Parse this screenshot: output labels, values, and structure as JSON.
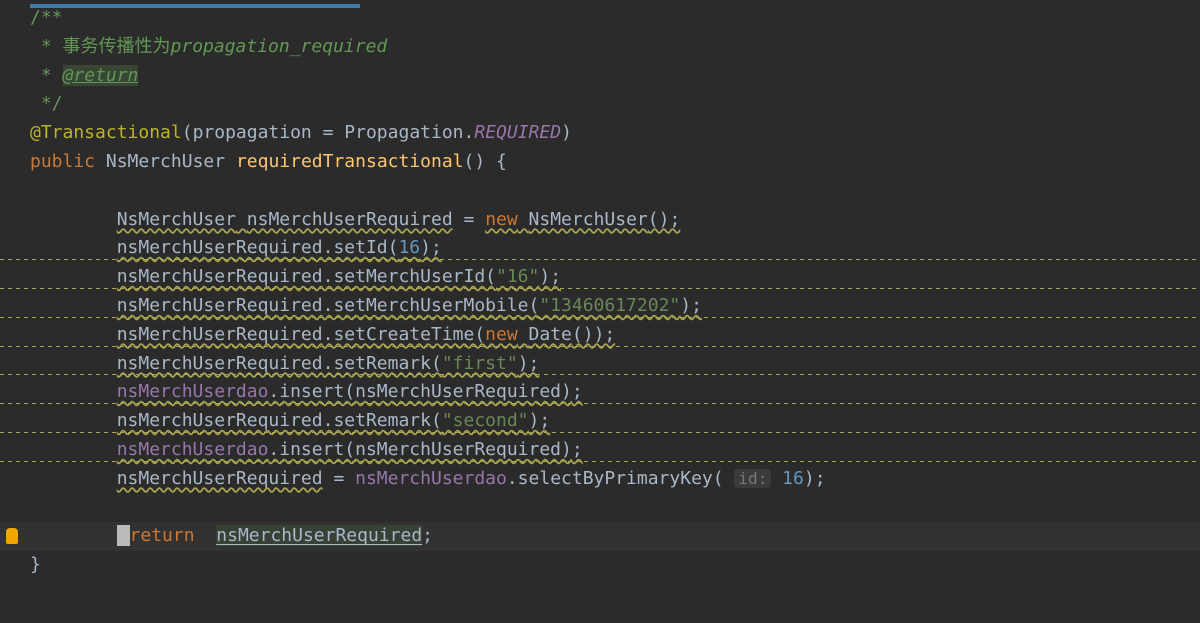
{
  "code": {
    "doc_open": "/**",
    "doc_line1_prefix": " * ",
    "doc_line1_text": "事务传播性为",
    "doc_line1_code": "propagation_required",
    "doc_line2_prefix": " * ",
    "doc_line2_tag": "@return",
    "doc_close": " */",
    "annotation": "@Transactional",
    "anno_param_name": "propagation",
    "anno_param_eq": " = ",
    "anno_param_class": "Propagation",
    "anno_param_dot": ".",
    "anno_param_const": "REQUIRED",
    "kw_public": "public",
    "ret_type": "NsMerchUser",
    "method_name": "requiredTransactional",
    "body_open": " {",
    "l1_type": "NsMerchUser",
    "l1_var": "nsMerchUserRequired",
    "l1_eq": " = ",
    "l1_new": "new",
    "l1_ctype": "NsMerchUser",
    "l1_tail": "();",
    "l2_var": "nsMerchUserRequired",
    "l2_call": ".setId(",
    "l2_arg": "16",
    "l2_tail": ");",
    "l3_var": "nsMerchUserRequired",
    "l3_call": ".setMerchUserId(",
    "l3_arg": "\"16\"",
    "l3_tail": ");",
    "l4_var": "nsMerchUserRequired",
    "l4_call": ".setMerchUserMobile(",
    "l4_arg": "\"13460617202\"",
    "l4_tail": ");",
    "l5_var": "nsMerchUserRequired",
    "l5_call": ".setCreateTime(",
    "l5_new": "new",
    "l5_ctype": "Date",
    "l5_tail": "());",
    "l6_var": "nsMerchUserRequired",
    "l6_call": ".setRemark(",
    "l6_arg": "\"first\"",
    "l6_tail": ");",
    "l7_var": "nsMerchUserdao",
    "l7_call": ".insert(nsMerchUserRequired)",
    "l7_tail": ";",
    "l8_var": "nsMerchUserRequired",
    "l8_call": ".setRemark(",
    "l8_arg": "\"second\"",
    "l8_tail": ");",
    "l9_var": "nsMerchUserdao",
    "l9_call": ".insert(nsMerchUserRequired)",
    "l9_tail": ";",
    "l10_lhs": "nsMerchUserRequired",
    "l10_eq": " = ",
    "l10_recv": "nsMerchUserdao",
    "l10_call": ".selectByPrimaryKey( ",
    "l10_hint": "id:",
    "l10_sp": " ",
    "l10_arg": "16",
    "l10_tail": ");",
    "ret_kw": "return",
    "ret_sp": "  ",
    "ret_expr": "nsMerchUserRequired",
    "ret_tail": ";",
    "body_close": "}"
  },
  "colors": {
    "comment": "#629755",
    "keyword": "#cc7832",
    "annotation": "#bbb529",
    "method": "#ffc66d",
    "field": "#9876aa",
    "number": "#6897bb",
    "string": "#6a8759",
    "text": "#a9b7c6",
    "bg": "#2b2b2b"
  }
}
